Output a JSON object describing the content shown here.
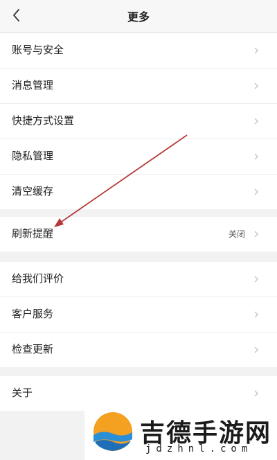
{
  "header": {
    "title": "更多",
    "back_icon": "chevron-left-icon"
  },
  "groups": [
    {
      "items": [
        {
          "label": "账号与安全"
        },
        {
          "label": "消息管理"
        },
        {
          "label": "快捷方式设置"
        },
        {
          "label": "隐私管理"
        },
        {
          "label": "清空缓存"
        }
      ]
    },
    {
      "items": [
        {
          "label": "刷新提醒",
          "value": "关闭"
        }
      ]
    },
    {
      "items": [
        {
          "label": "给我们评价"
        },
        {
          "label": "客户服务"
        },
        {
          "label": "检查更新"
        }
      ]
    },
    {
      "items": [
        {
          "label": "关于"
        }
      ]
    }
  ],
  "annotation": {
    "color": "#b53a3a",
    "points_to": "刷新提醒"
  },
  "watermark": {
    "name": "吉德手游网",
    "url": "jdzhnl.com"
  },
  "colors": {
    "background": "#f2f2f2",
    "row_bg": "#ffffff",
    "chevron": "#c4c4c4"
  }
}
